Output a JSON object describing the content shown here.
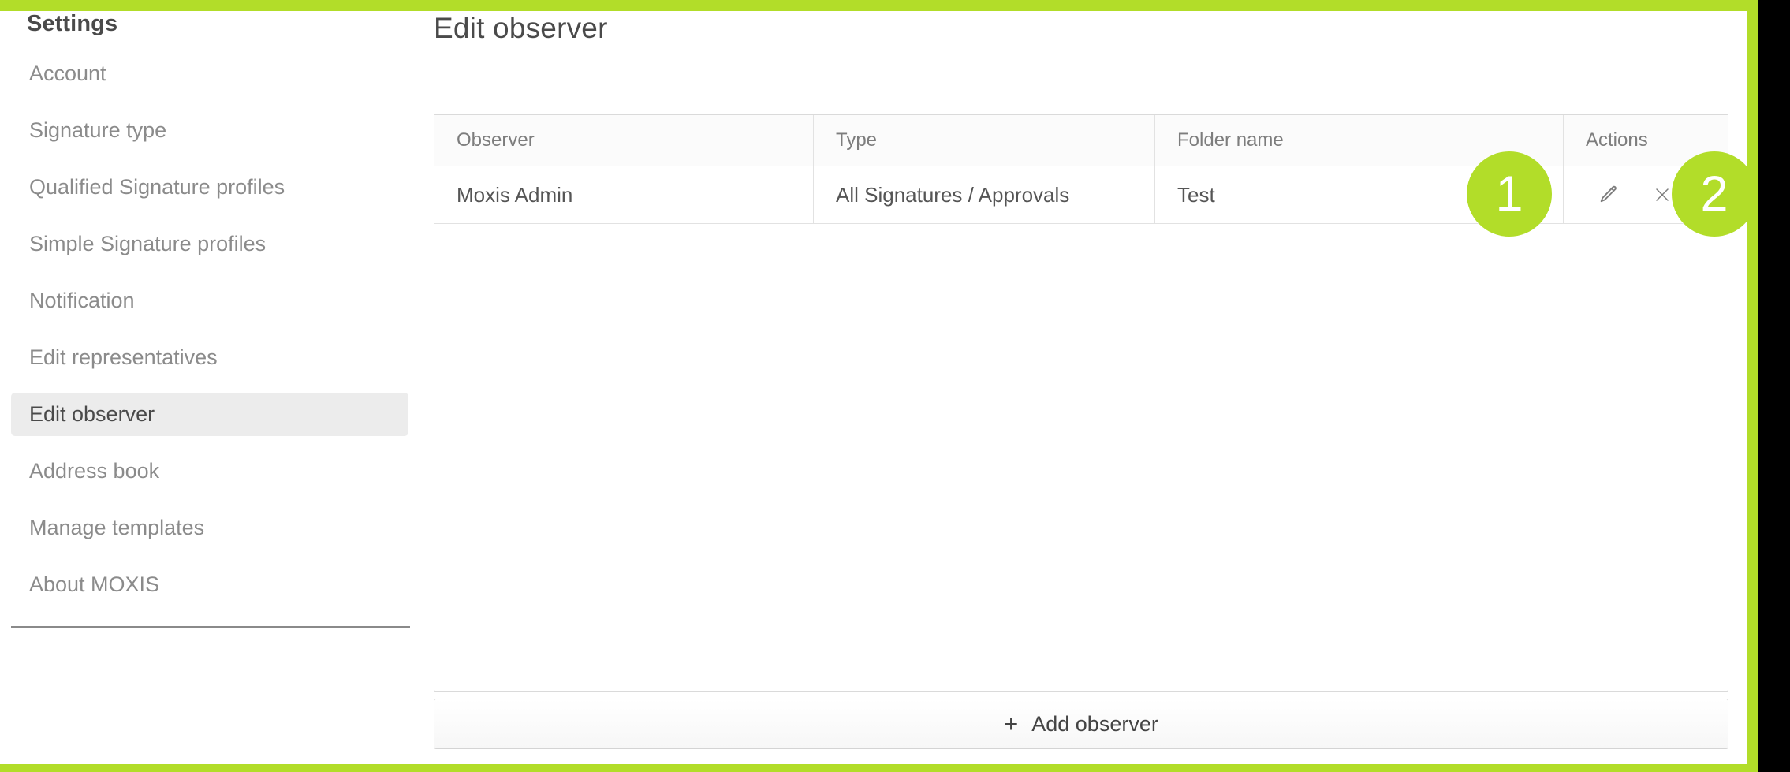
{
  "theme": {
    "accent_green": "#b2dd29",
    "text_gray": "#7d7d7d",
    "active_bg": "#ececec"
  },
  "sidebar": {
    "title": "Settings",
    "items": [
      {
        "label": "Account",
        "active": false
      },
      {
        "label": "Signature type",
        "active": false
      },
      {
        "label": "Qualified Signature profiles",
        "active": false
      },
      {
        "label": "Simple Signature profiles",
        "active": false
      },
      {
        "label": "Notification",
        "active": false
      },
      {
        "label": "Edit representatives",
        "active": false
      },
      {
        "label": "Edit observer",
        "active": true
      },
      {
        "label": "Address book",
        "active": false
      },
      {
        "label": "Manage templates",
        "active": false
      },
      {
        "label": "About MOXIS",
        "active": false
      }
    ]
  },
  "main": {
    "page_title": "Edit observer",
    "table": {
      "columns": [
        "Observer",
        "Type",
        "Folder name",
        "Actions"
      ],
      "rows": [
        {
          "observer": "Moxis Admin",
          "type": "All Signatures / Approvals",
          "folder_name": "Test",
          "actions": [
            "edit-pencil-icon",
            "delete-close-icon"
          ]
        }
      ]
    },
    "add_observer": {
      "plus": "+",
      "label": "Add observer"
    }
  },
  "annotations": {
    "badges": [
      {
        "number": "1"
      },
      {
        "number": "2"
      }
    ]
  }
}
